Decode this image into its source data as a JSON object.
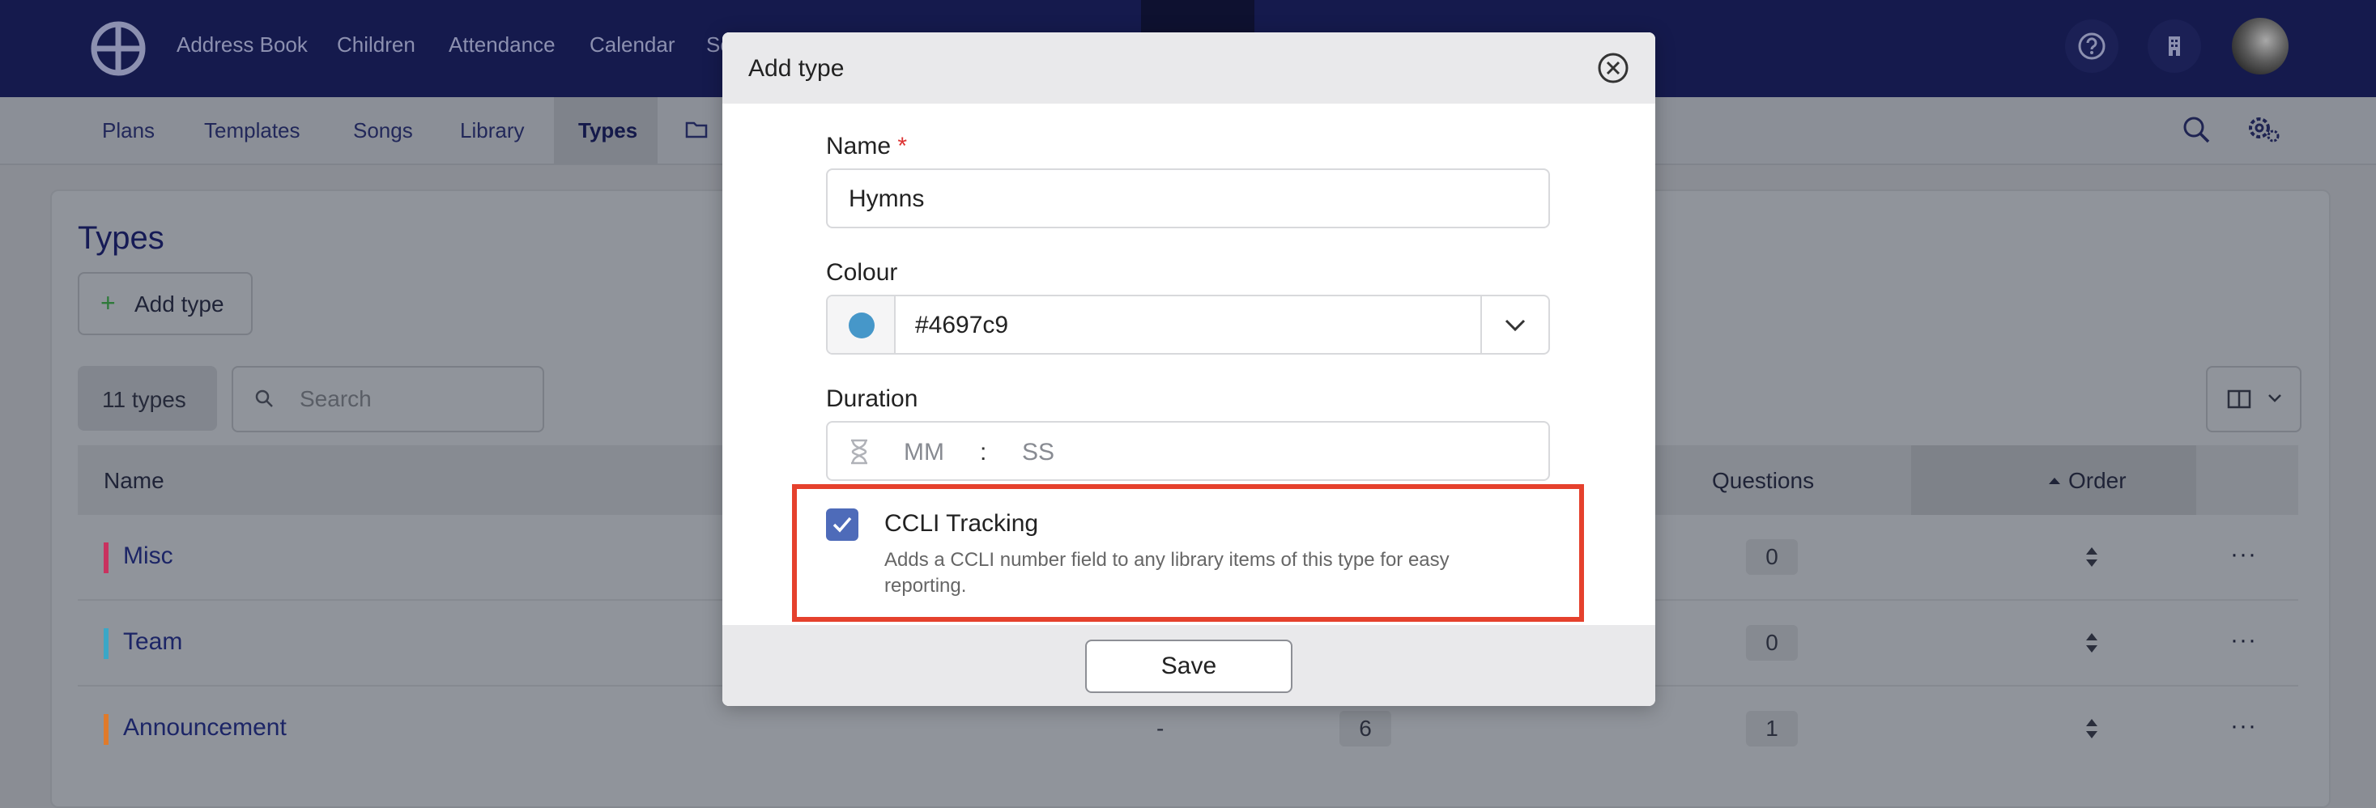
{
  "topnav": {
    "links": [
      "Address Book",
      "Children",
      "Attendance",
      "Calendar",
      "Sc"
    ]
  },
  "subnav": {
    "tabs": [
      "Plans",
      "Templates",
      "Songs",
      "Library",
      "Types"
    ],
    "active_tab": "Types"
  },
  "page": {
    "title": "Types",
    "add_button_label": "Add type",
    "count_label": "11 types",
    "search_placeholder": "Search",
    "columns": {
      "name": "Name",
      "questions": "Questions",
      "order": "Order"
    },
    "rows": [
      {
        "name": "Misc",
        "color": "#c9325f",
        "questions": "0"
      },
      {
        "name": "Team",
        "color": "#3aa7c7",
        "questions": "0"
      },
      {
        "name": "Announcement",
        "color": "#e07a2a",
        "dash": "-",
        "count": "6",
        "questions": "1"
      }
    ]
  },
  "modal": {
    "title": "Add type",
    "name_label": "Name",
    "required_marker": "*",
    "name_value": "Hymns",
    "colour_label": "Colour",
    "colour_value": "#4697c9",
    "duration_label": "Duration",
    "duration_mm_placeholder": "MM",
    "duration_separator": ":",
    "duration_ss_placeholder": "SS",
    "ccli_label": "CCLI Tracking",
    "ccli_checked": true,
    "ccli_description": "Adds a CCLI number field to any library items of this type for easy reporting.",
    "save_label": "Save"
  },
  "icons": {
    "logo": "wheel-logo-icon",
    "help": "question-circle-icon",
    "org": "building-icon",
    "search": "search-icon",
    "settings": "gear-icon",
    "folder": "folder-icon",
    "close": "close-circle-icon",
    "chevron": "chevron-down-icon",
    "hourglass": "hourglass-icon",
    "check": "check-icon",
    "sort": "sort-icon",
    "more": "more-dots-icon",
    "columns": "columns-icon"
  },
  "colors": {
    "nav_bg": "#151a4d",
    "checkbox": "#4e6bb9",
    "highlight": "#e5412d"
  }
}
